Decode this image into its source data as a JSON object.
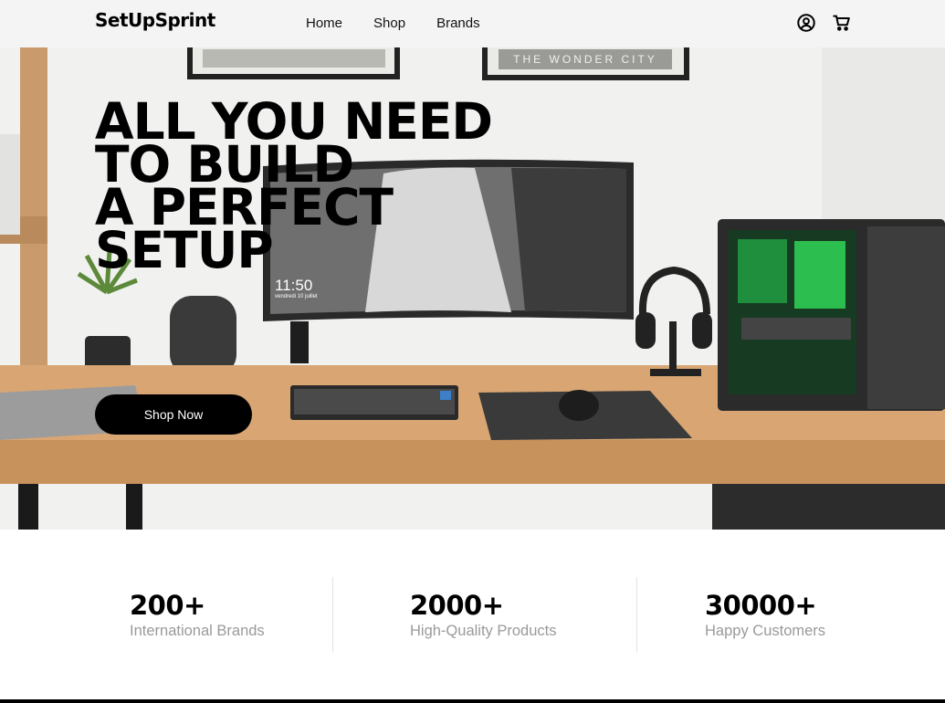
{
  "brand": {
    "logo": "SetUpSprint"
  },
  "nav": {
    "items": [
      "Home",
      "Shop",
      "Brands"
    ]
  },
  "header_icons": {
    "account": "user-circle-icon",
    "cart": "shopping-cart-icon"
  },
  "hero": {
    "headline_lines": [
      "ALL YOU NEED",
      "TO BUILD",
      "A PERFECT",
      "SETUP"
    ],
    "cta_label": "Shop Now",
    "poster_text": "THE WONDER CITY",
    "monitor_time": "11:50",
    "monitor_date": "vendredi 10 juillet"
  },
  "stats": [
    {
      "value": "200+",
      "label": "International Brands"
    },
    {
      "value": "2000+",
      "label": "High-Quality Products"
    },
    {
      "value": "30000+",
      "label": "Happy Customers"
    }
  ],
  "colors": {
    "header_bg": "#f4f4f4",
    "button_bg": "#000000",
    "stat_label": "#9a9a9a",
    "desk": "#d9a673"
  }
}
